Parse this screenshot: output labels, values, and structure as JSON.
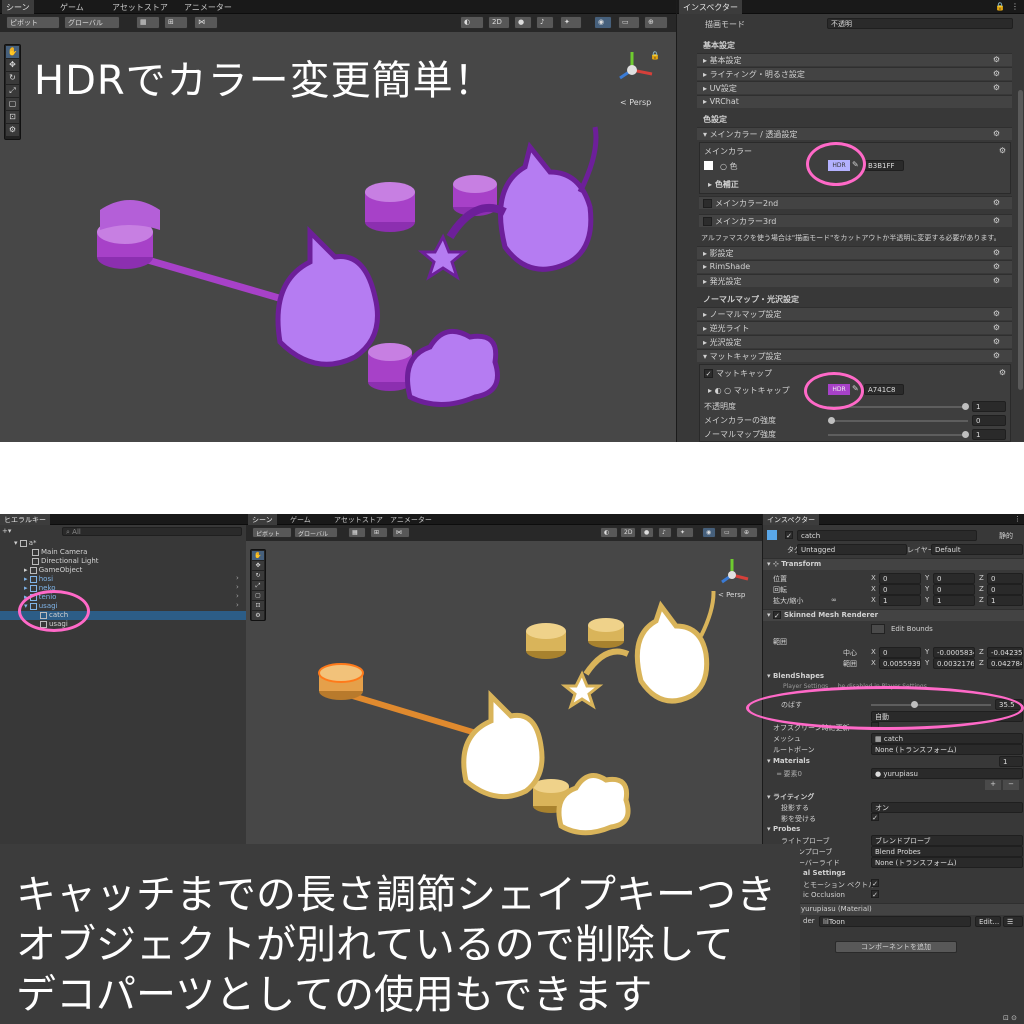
{
  "top": {
    "tabs": [
      "シーン",
      "ゲーム",
      "アセットストア",
      "アニメーター"
    ],
    "toolbar": {
      "pivot": "ピボット",
      "global": "グローバル",
      "mode_2d": "2D"
    },
    "headline": "HDRでカラー変更簡単！",
    "persp": "< Persp",
    "inspector": {
      "tab": "インスペクター",
      "render_mode_label": "描画モード",
      "render_mode_value": "不透明",
      "basic_header": "基本設定",
      "basic_items": [
        "基本設定",
        "ライティング・明るさ設定",
        "UV設定",
        "VRChat"
      ],
      "color_header": "色設定",
      "main_color_section": "メインカラー / 透過設定",
      "main_color_label": "メインカラー",
      "color_field_label": "色",
      "hdr": "HDR",
      "color_hex": "B3B1FF",
      "color_correction": "色補正",
      "main2": "メインカラー2nd",
      "main3": "メインカラー3rd",
      "alpha_note": "アルファマスクを使う場合は\"描画モード\"をカットアウトか半透明に変更する必要があります。",
      "shade_items": [
        "影設定",
        "RimShade",
        "発光設定"
      ],
      "normal_header": "ノーマルマップ・光沢設定",
      "normal_items": [
        "ノーマルマップ設定",
        "逆光ライト",
        "光沢設定"
      ],
      "matcap_section": "マットキャップ設定",
      "matcap_label": "マットキャップ",
      "matcap_field": "マットキャップ",
      "matcap_hex": "A741C8",
      "opacity_label": "不透明度",
      "opacity_value": "1",
      "main_strength_label": "メインカラーの強度",
      "main_strength_value": "0",
      "normal_strength_label": "ノーマルマップ強度",
      "normal_strength_value": "1"
    }
  },
  "bottom": {
    "hierarchy": {
      "tab": "ヒエラルキー",
      "search": "All",
      "scene": "a*",
      "items": [
        "Main Camera",
        "Directional Light",
        "GameObject",
        "hosi",
        "neko",
        "tenio",
        "usagi",
        "catch",
        "usagi"
      ]
    },
    "scene_tabs": [
      "シーン",
      "ゲーム",
      "アセットストア",
      "アニメーター"
    ],
    "toolbar": {
      "pivot": "ピボット",
      "global": "グローバル",
      "mode_2d": "2D"
    },
    "inspector": {
      "tab": "インスペクター",
      "object_name": "catch",
      "static_label": "静的",
      "tag_label": "タグ",
      "tag_value": "Untagged",
      "layer_label": "レイヤー",
      "layer_value": "Default",
      "transform_header": "Transform",
      "position_label": "位置",
      "rotation_label": "回転",
      "scale_label": "拡大/縮小",
      "position": [
        "0",
        "0",
        "0"
      ],
      "rotation": [
        "0",
        "0",
        "0"
      ],
      "scale": [
        "1",
        "1",
        "1"
      ],
      "smr_header": "Skinned Mesh Renderer",
      "edit_bounds": "Edit Bounds",
      "bounds_label": "範囲",
      "center_label": "中心",
      "extent_label": "範囲",
      "center": [
        "0",
        "-0.00058347",
        "-0.04235007"
      ],
      "extent": [
        "0.005593913",
        "0.003217662",
        "0.04278455"
      ],
      "blendshapes_header": "BlendShapes",
      "blend_note": "Player Settings ... be disabled in Player Settings.",
      "blend_key_label": "のばす",
      "blend_key_value": "35.5",
      "quality_value": "自動",
      "offscreen_label": "オフスクリーン時に更新",
      "mesh_label": "メッシュ",
      "mesh_value": "catch",
      "root_bone_label": "ルートボーン",
      "root_bone_value": "None (トランスフォーム)",
      "materials_header": "Materials",
      "materials_count": "1",
      "element0_label": "要素0",
      "element0_value": "yurupiasu",
      "lighting_header": "ライティング",
      "cast_shadows_label": "投影する",
      "cast_shadows_value": "オン",
      "receive_shadows_label": "影を受ける",
      "probes_header": "Probes",
      "light_probes_label": "ライトプローブ",
      "light_probes_value": "ブレンドプローブ",
      "reflection_probes_label": "ョンプローブ",
      "reflection_probes_value": "Blend Probes",
      "anchor_override_label": "オーバーライド",
      "anchor_override_value": "None (トランスフォーム)",
      "additional_header": "al Settings",
      "motion_vectors_label": "とモーション ベクトル",
      "occlusion_label": "ic Occlusion",
      "material_name": "yurupiasu (Material)",
      "shader_label": "der",
      "shader_value": "lilToon",
      "edit_button": "Edit...",
      "add_component": "コンポーネントを追加"
    },
    "caption_lines": [
      "キャッチまでの長さ調節シェイプキーつき",
      "オブジェクトが別れているので削除して",
      "デコパーツとしての使用もできます"
    ]
  },
  "colors": {
    "accent_ring": "#ff69c8",
    "purple_model": "#a741c8",
    "lavender": "#b3b1ff",
    "gold": "#d9b45a",
    "selection": "#2c5d87"
  }
}
